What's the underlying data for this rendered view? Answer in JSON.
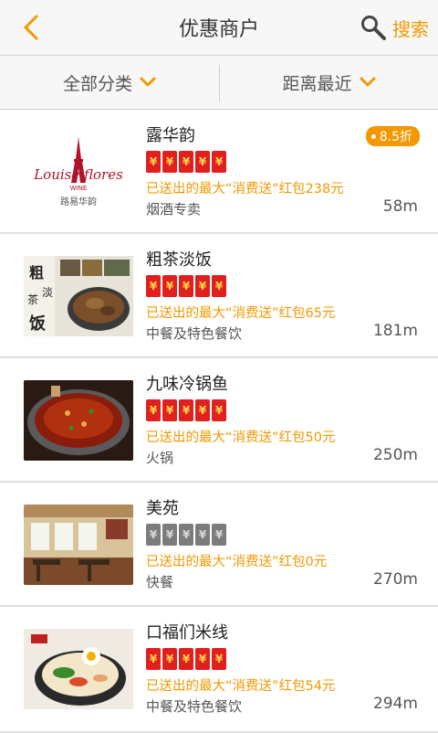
{
  "header": {
    "title": "优惠商户",
    "search_label": "搜索",
    "back_icon": "chevron-left-icon",
    "search_icon": "magnifier-icon"
  },
  "filters": {
    "category": "全部分类",
    "sort": "距离最近"
  },
  "colors": {
    "accent": "#f39800",
    "packet_red": "#e21f1f",
    "packet_gray": "#7c7c7c"
  },
  "merchants": [
    {
      "name": "露华韵",
      "badge": "8.5折",
      "packets": 5,
      "active": true,
      "promo": "已送出的最大“消费送”红包238元",
      "category": "烟酒专卖",
      "distance": "58m",
      "logo_text": "Louise flores",
      "logo_sub": "WINE",
      "logo_cn": "路易华韵"
    },
    {
      "name": "粗茶淡饭",
      "badge": "",
      "packets": 5,
      "active": true,
      "promo": "已送出的最大“消费送”红包65元",
      "category": "中餐及特色餐饮",
      "distance": "181m"
    },
    {
      "name": "九味冷锅鱼",
      "badge": "",
      "packets": 5,
      "active": true,
      "promo": "已送出的最大“消费送”红包50元",
      "category": "火锅",
      "distance": "250m"
    },
    {
      "name": "美苑",
      "badge": "",
      "packets": 5,
      "active": false,
      "promo": "已送出的最大“消费送”红包0元",
      "category": "快餐",
      "distance": "270m"
    },
    {
      "name": "口福们米线",
      "badge": "",
      "packets": 5,
      "active": true,
      "promo": "已送出的最大“消费送”红包54元",
      "category": "中餐及特色餐饮",
      "distance": "294m"
    }
  ]
}
